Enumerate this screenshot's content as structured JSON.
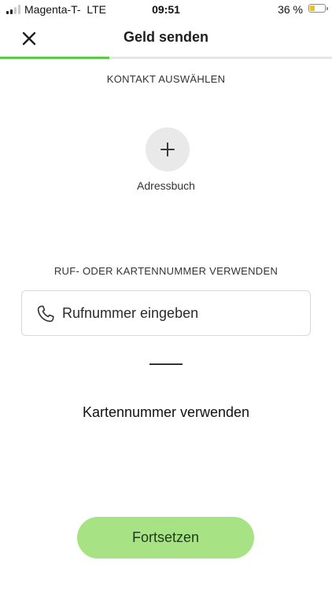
{
  "status_bar": {
    "carrier": "Magenta-T-",
    "network": "LTE",
    "time": "09:51",
    "battery_percent": "36 %",
    "battery_level": 0.36,
    "signal_bars_active": 2,
    "signal_bars_total": 4
  },
  "header": {
    "title": "Geld senden",
    "close_icon": "close-icon"
  },
  "progress": {
    "step_fraction": 0.33,
    "color": "#5cc94a"
  },
  "contact_section": {
    "heading": "KONTAKT AUSWÄHLEN",
    "add_icon": "plus-icon",
    "address_book_label": "Adressbuch"
  },
  "number_section": {
    "heading": "RUF- ODER KARTENNUMMER VERWENDEN",
    "phone_icon": "phone-icon",
    "phone_value": "",
    "phone_placeholder": "Rufnummer eingeben",
    "card_number_link": "Kartennummer verwenden"
  },
  "footer": {
    "continue_label": "Fortsetzen",
    "continue_color": "#a7e285"
  }
}
